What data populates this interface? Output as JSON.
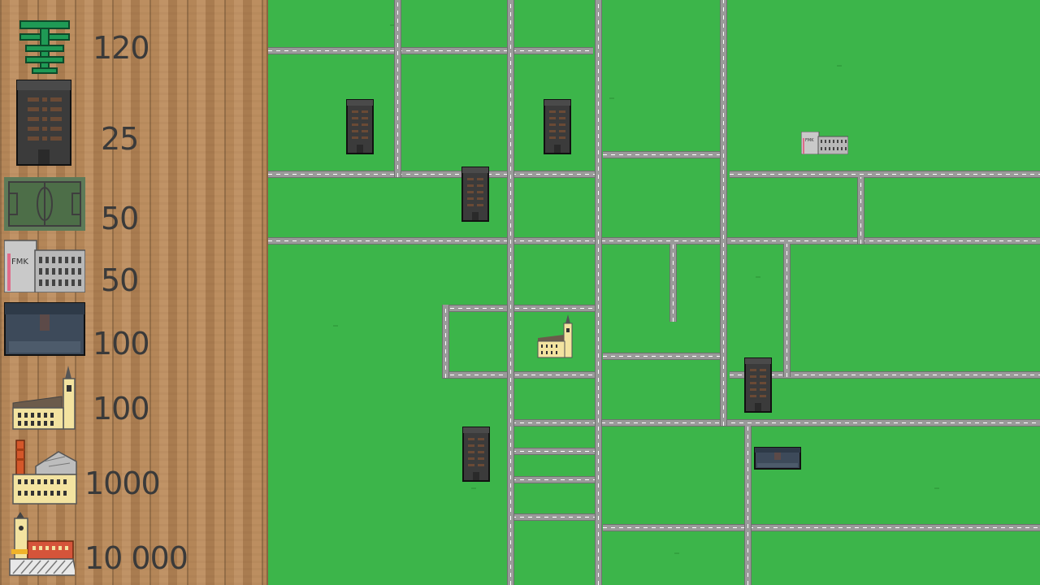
{
  "shop": {
    "currency_amount": "120",
    "items": [
      {
        "name": "apartment",
        "price": "25"
      },
      {
        "name": "stadium",
        "price": "50"
      },
      {
        "name": "university",
        "price": "50"
      },
      {
        "name": "warehouse",
        "price": "100"
      },
      {
        "name": "church",
        "price": "100"
      },
      {
        "name": "factory",
        "price": "1000"
      },
      {
        "name": "town-hall",
        "price": "10 000"
      }
    ]
  },
  "map": {
    "colors": {
      "grass": "#3cb54a",
      "road": "#9a9a9a"
    },
    "buildings": [
      {
        "type": "apartment"
      },
      {
        "type": "apartment"
      },
      {
        "type": "apartment"
      },
      {
        "type": "apartment"
      },
      {
        "type": "apartment"
      },
      {
        "type": "university",
        "label": "FMK"
      },
      {
        "type": "church"
      },
      {
        "type": "warehouse"
      }
    ]
  }
}
